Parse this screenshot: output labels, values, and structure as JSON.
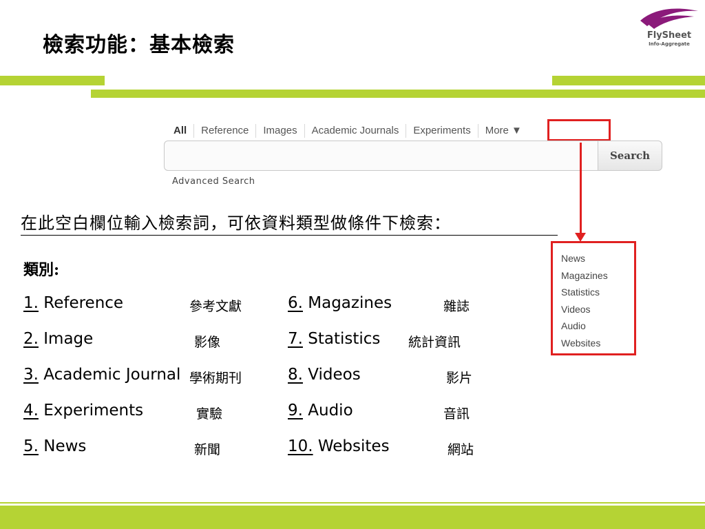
{
  "slide": {
    "title": "檢索功能：基本檢索"
  },
  "logo": {
    "name": "FlySheet",
    "tagline": "Info-Aggregate"
  },
  "search_widget": {
    "tabs": [
      "All",
      "Reference",
      "Images",
      "Academic Journals",
      "Experiments",
      "More ▼"
    ],
    "search_button": "Search",
    "input_value": "",
    "advanced_link": "Advanced Search"
  },
  "dropdown": {
    "items": [
      "News",
      "Magazines",
      "Statistics",
      "Videos",
      "Audio",
      "Websites"
    ]
  },
  "instruction": "在此空白欄位輸入檢索詞，可依資料類型做條件下檢索：",
  "categories": {
    "heading": "類別:",
    "items": [
      {
        "num": "1.",
        "en": "Reference",
        "zh": "參考文獻"
      },
      {
        "num": "2.",
        "en": "Image",
        "zh": "影像"
      },
      {
        "num": "3.",
        "en": "Academic Journal",
        "zh": "學術期刊"
      },
      {
        "num": "4.",
        "en": "Experiments",
        "zh": "實驗"
      },
      {
        "num": "5.",
        "en": "News",
        "zh": "新聞"
      },
      {
        "num": "6.",
        "en": "Magazines",
        "zh": "雜誌"
      },
      {
        "num": "7.",
        "en": "Statistics",
        "zh": "統計資訊"
      },
      {
        "num": "8.",
        "en": "Videos",
        "zh": "影片"
      },
      {
        "num": "9.",
        "en": "Audio",
        "zh": "音訊"
      },
      {
        "num": "10.",
        "en": "Websites",
        "zh": "網站"
      }
    ]
  },
  "colors": {
    "accent_green": "#b5d334",
    "highlight_red": "#e02020",
    "logo_purple": "#8b1a7a"
  }
}
